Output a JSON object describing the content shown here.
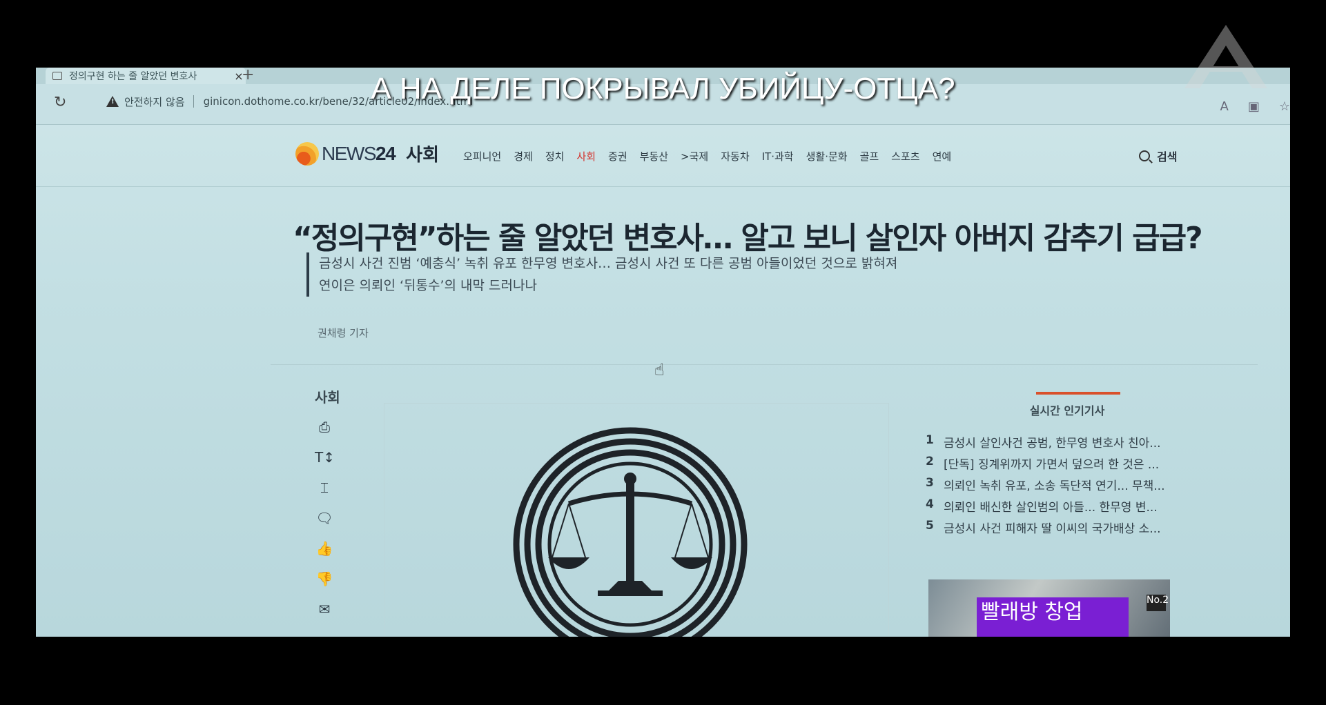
{
  "browser": {
    "tab_title": "정의구현 하는 줄 알았던 변호사",
    "tab_close": "×",
    "new_tab": "+",
    "security_label": "안전하지 않음",
    "url": "ginicon.dothome.co.kr/bene/32/article02/index.html"
  },
  "site": {
    "logo_text_prefix": "NEWS",
    "logo_text_num": "24",
    "section": "사회",
    "menu": [
      "오피니언",
      "경제",
      "정치",
      "사회",
      "증권",
      "부동산",
      ">국제",
      "자동차",
      "IT·과학",
      "생활·문화",
      "골프",
      "스포츠",
      "연예"
    ],
    "active_menu": "사회",
    "search_label": "검색"
  },
  "article": {
    "headline": "“정의구현”하는 줄 알았던 변호사… 알고 보니 살인자 아버지 감추기 급급?",
    "subhead_line1": "금성시 사건 진범 ‘예충식’ 녹취 유포 한무영 변호사… 금성시 사건 또 다른 공범 아들이었던 것으로 밝혀져",
    "subhead_line2": "연이은 의뢰인 ‘뒤통수’의 내막 드러나나",
    "byline": "권채령 기자",
    "sidebar_section": "사회"
  },
  "popular": {
    "title": "실시간 인기기사",
    "items": [
      {
        "num": "1",
        "text": "금성시 살인사건 공범, 한무영 변호사 친아..."
      },
      {
        "num": "2",
        "text": "[단독] 징계위까지 가면서 덮으려 한 것은 ..."
      },
      {
        "num": "3",
        "text": "의뢰인 녹취 유포, 소송 독단적 연기... 무책..."
      },
      {
        "num": "4",
        "text": "의뢰인 배신한 살인범의 아들... 한무영 변..."
      },
      {
        "num": "5",
        "text": "금성시 사건 피해자 딸 이씨의 국가배상 소..."
      }
    ]
  },
  "ad": {
    "text": "빨래방 창업",
    "badge": "No.2"
  },
  "overlay": {
    "subtitle": "А НА ДЕЛЕ ПОКРЫВАЛ УБИЙЦУ-ОТЦА?"
  },
  "colors": {
    "accent": "#d3312b",
    "screen_bg": "#c3dfe3",
    "ad_purple": "#7a1fd3"
  }
}
